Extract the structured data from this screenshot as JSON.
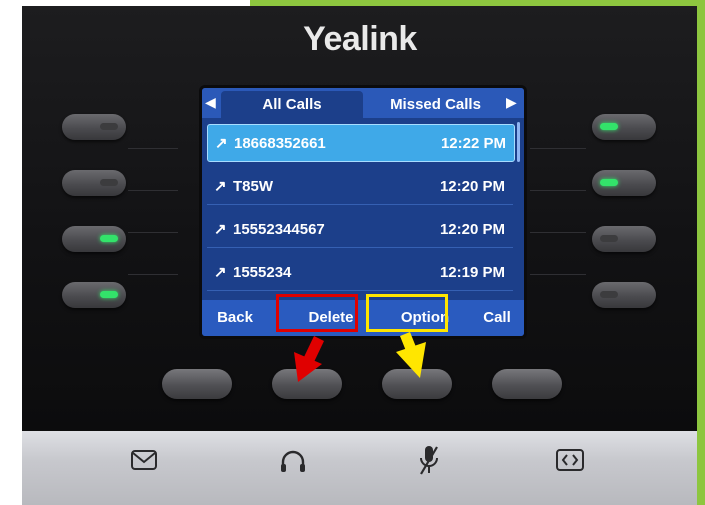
{
  "device": {
    "brand": "Yealink"
  },
  "screen": {
    "tabs": [
      {
        "label": "All Calls",
        "active": true
      },
      {
        "label": "Missed Calls",
        "active": false
      }
    ],
    "call_log": [
      {
        "direction_icon": "↗",
        "number": "18668352661",
        "time": "12:22 PM",
        "selected": true
      },
      {
        "direction_icon": "↗",
        "number": "T85W",
        "time": "12:20 PM",
        "selected": false
      },
      {
        "direction_icon": "↗",
        "number": "15552344567",
        "time": "12:20 PM",
        "selected": false
      },
      {
        "direction_icon": "↗",
        "number": "1555234",
        "time": "12:19 PM",
        "selected": false
      }
    ],
    "softkeys": {
      "back": "Back",
      "delete": "Delete",
      "option": "Option",
      "call": "Call"
    }
  },
  "line_keys": {
    "left_leds": [
      "off",
      "off",
      "green",
      "green"
    ],
    "right_leds": [
      "green",
      "green",
      "off",
      "off"
    ]
  },
  "annotations": {
    "delete_highlight_color": "#e00000",
    "option_highlight_color": "#ffe600"
  },
  "base_icons": [
    "message-icon",
    "headset-icon",
    "mute-icon",
    "transfer-icon"
  ],
  "colors": {
    "frame_accent": "#8dc63f",
    "screen_bg": "#1c3f8a",
    "selected_row": "#3fa9e8",
    "led_on": "#33e36a"
  }
}
